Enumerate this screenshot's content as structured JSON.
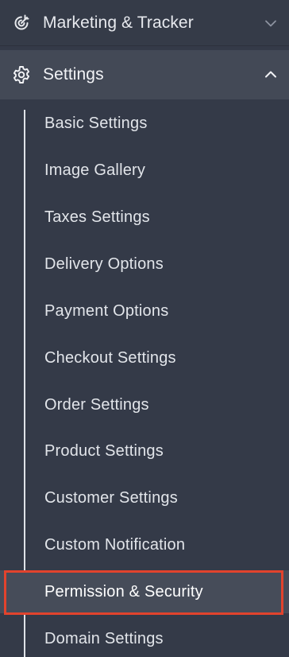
{
  "colors": {
    "background": "#343a48",
    "active_row": "#434956",
    "highlight": "#e2432d",
    "text": "#e6e8ec"
  },
  "marketing": {
    "label": "Marketing & Tracker",
    "icon": "target-icon",
    "chevron": "chevron-down-icon",
    "expanded": false
  },
  "settings": {
    "label": "Settings",
    "icon": "gear-icon",
    "chevron": "chevron-up-icon",
    "expanded": true,
    "items": [
      {
        "label": "Basic Settings"
      },
      {
        "label": "Image Gallery"
      },
      {
        "label": "Taxes Settings"
      },
      {
        "label": "Delivery Options"
      },
      {
        "label": "Payment Options"
      },
      {
        "label": "Checkout Settings"
      },
      {
        "label": "Order Settings"
      },
      {
        "label": "Product Settings"
      },
      {
        "label": "Customer Settings"
      },
      {
        "label": "Custom Notification"
      },
      {
        "label": "Permission & Security",
        "active": true
      },
      {
        "label": "Domain Settings"
      }
    ]
  }
}
